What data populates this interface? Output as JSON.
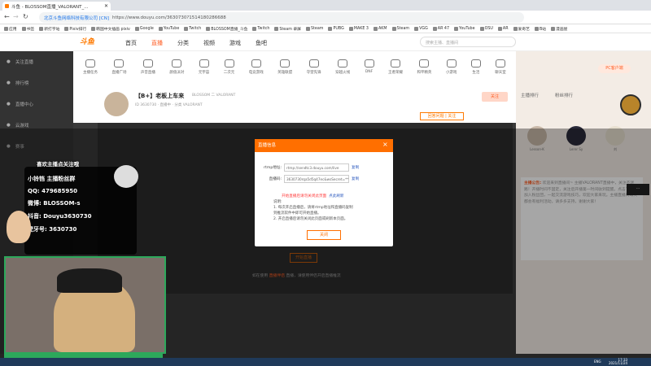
{
  "browser": {
    "tab_title": "斗鱼 - BLOSSOM直播_VALORANT_...",
    "secure_label": "北京斗鱼网络科技有限公司 [CN]",
    "url": "https://www.douyu.com/3630730?1514180286688",
    "bookmarks": [
      "应用",
      "书签",
      "新打字站",
      "Pixiv排行",
      "韩国中文插画 pixiv",
      "Google",
      "YouTube",
      "Twitch",
      "BLOSSOM直播_斗鱼",
      "Twitch",
      "Steam 录屏",
      "Steam",
      "PUBG",
      "MAKE 3",
      "AKM",
      "Steam",
      "VGG",
      "AR 47",
      "YouTube",
      "OSU",
      "AR",
      "爱奇艺",
      "B站",
      "漫画屋"
    ]
  },
  "site": {
    "logo": "斗鱼",
    "nav": [
      "首页",
      "直播",
      "分类",
      "视频",
      "游戏",
      "鱼吧"
    ],
    "search_placeholder": "搜索主播、直播间"
  },
  "sidebar": [
    "关注直播",
    "排行榜",
    "直播中心",
    "云游戏",
    "赛事"
  ],
  "categories": [
    "主播任务",
    "直播广场",
    "声音直播",
    "颜值派对",
    "元宇宙",
    "二次元",
    "电竞游戏",
    "英雄联盟",
    "守望先锋",
    "穿越火线",
    "DNF",
    "王者荣耀",
    "和平精英",
    "小游戏",
    "生活",
    "聊天室"
  ],
  "room": {
    "title": "【B+】老板上车来",
    "subtitle": "BLOSSOM 二 VALORANT",
    "info": "ID 3630730  ·  直播中  ·  分类 VALORANT",
    "follow": "关注",
    "badge": "回答问题 | 关注"
  },
  "right_panel": {
    "pc_label": "PC客户端",
    "tabs": [
      "主播排行",
      "粉丝排行"
    ],
    "ranks": [
      {
        "name": "Lesson-K"
      },
      {
        "name": "Lerer Sy"
      },
      {
        "name": "刘"
      }
    ],
    "notice_label": "主播公告:",
    "notice_text": "欢迎来到直播间~ 主播VALORANT直播中，关注不迷路！开播时间不固定，关注后开播第一时间收到提醒。点击下方可加入粉丝团，一起交流游戏技巧，欢迎大家来玩。主播直播间每天都会有福利活动，请多多支持，谢谢大家！"
  },
  "dialog": {
    "title": "直播信息",
    "rtmp_label": "rtmp地址:",
    "rtmp_value": "rtmp://sendtc3.douyu.com/live",
    "key_label": "直播码:",
    "key_value": "3630730rqa5d5q47ec&wsSecret=*********",
    "copy": "复制",
    "warning": "开始直播后请勿关闭此页面",
    "reset": "点此刷新",
    "notes": [
      "说明:",
      "1. 每次开启直播后，请将rtmp地址和直播码复制",
      "   到推流软件中即可开始直播。",
      "2. 开启直播后请勿关闭此页面或刷新本页面。"
    ],
    "close_button": "关闭"
  },
  "player": {
    "under_button": "开始直播",
    "tip_prefix": "如在使用",
    "tip_link": "直播伴侣",
    "tip_suffix": "直播，请使用伴侣开启直播推流"
  },
  "stream_overlay": {
    "header": "喜欢主播点关注哦",
    "line1": "小铃铛 主播粉丝群",
    "qq": "QQ: 479685950",
    "weibo": "微博: BLOSSOM-s",
    "douyin": "抖音: Douyu3630730",
    "kuaishou": "虎牙号: 3630730"
  },
  "taskbar": {
    "time": "17:33",
    "date": "2021/11/24",
    "lang": "ENG"
  },
  "colors": {
    "accent": "#ff6f00",
    "webcam_frame": "#2da85b"
  },
  "icons": [
    "back-icon",
    "forward-icon",
    "reload-icon",
    "home-icon",
    "close-icon",
    "gear-icon"
  ]
}
